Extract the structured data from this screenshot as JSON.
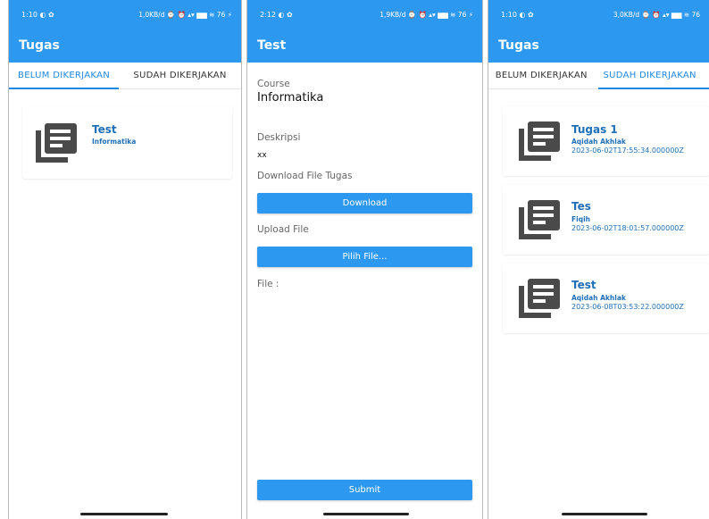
{
  "colors": {
    "primary": "#2d98f0",
    "accent": "#1e88e5",
    "card_text": "#1e6fb8",
    "icon": "#4a4a4a"
  },
  "icons": {
    "card": "document-list-icon",
    "status_settings": "gear-icon"
  },
  "screen1": {
    "status_time": "1:10",
    "status_right": "1,0KB/d ⌚ ⏰ ▴▾ ▆▆ ≋ 76 ⚡",
    "title": "Tugas",
    "tabs": [
      {
        "label": "BELUM DIKERJAKAN",
        "active": true
      },
      {
        "label": "SUDAH DIKERJAKAN",
        "active": false
      }
    ],
    "items": [
      {
        "title": "Test",
        "subtitle": "Informatika"
      }
    ]
  },
  "screen2": {
    "status_time": "2:12",
    "status_right": "1,9KB/d ⌚ ⏰ ▴▾ ▆▆ ≋ 76 ⚡",
    "title": "Test",
    "course_label": "Course",
    "course_value": "Informatika",
    "desc_label": "Deskripsi",
    "desc_value": "xx",
    "download_label": "Download File Tugas",
    "download_button": "Download",
    "upload_label": "Upload File",
    "pick_button": "Pilih File...",
    "file_label": "File :",
    "submit_button": "Submit"
  },
  "screen3": {
    "status_time": "1:10",
    "status_right": "3,0KB/d ⌚ ⏰ ▴▾ ▆▆ ≋ 76",
    "title": "Tugas",
    "tabs": [
      {
        "label": "BELUM DIKERJAKAN",
        "active": false
      },
      {
        "label": "SUDAH DIKERJAKAN",
        "active": true
      }
    ],
    "items": [
      {
        "title": "Tugas 1",
        "subtitle": "Aqidah Akhlak",
        "date": "2023-06-02T17:55:34.000000Z"
      },
      {
        "title": "Tes",
        "subtitle": "Fiqih",
        "date": "2023-06-02T18:01:57.000000Z"
      },
      {
        "title": "Test",
        "subtitle": "Aqidah Akhlak",
        "date": "2023-06-08T03:53:22.000000Z"
      }
    ]
  }
}
